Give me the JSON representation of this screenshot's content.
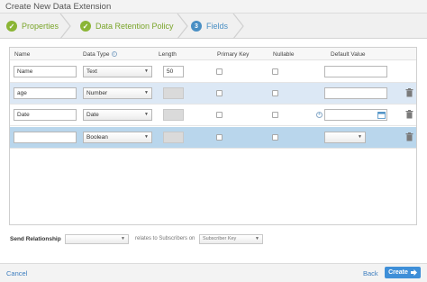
{
  "window": {
    "title": "Create New Data Extension"
  },
  "steps": [
    {
      "label": "Properties",
      "marker": "✓",
      "state": "complete"
    },
    {
      "label": "Data Retention Policy",
      "marker": "✓",
      "state": "complete"
    },
    {
      "label": "Fields",
      "marker": "3",
      "state": "active"
    }
  ],
  "table": {
    "headers": {
      "name": "Name",
      "data_type": "Data Type",
      "length": "Length",
      "primary_key": "Primary Key",
      "nullable": "Nullable",
      "default_value": "Default Value"
    },
    "info_icon": "i",
    "rows": [
      {
        "name": "Name",
        "data_type": "Text",
        "length": "50",
        "length_enabled": true,
        "primary_key": false,
        "nullable": false,
        "default_value": ""
      },
      {
        "name": "age",
        "data_type": "Number",
        "length": "",
        "length_enabled": false,
        "primary_key": false,
        "nullable": false,
        "default_value": ""
      },
      {
        "name": "Date",
        "data_type": "Date",
        "length": "",
        "length_enabled": false,
        "primary_key": false,
        "nullable": false,
        "default_value": ""
      },
      {
        "name": "",
        "data_type": "Boolean",
        "length": "",
        "length_enabled": false,
        "primary_key": false,
        "nullable": false,
        "default_value": ""
      }
    ]
  },
  "relationship": {
    "label": "Send Relationship",
    "field_value": "",
    "connector": "relates to Subscribers on",
    "subscriber_field": "Subscriber Key"
  },
  "footer": {
    "cancel": "Cancel",
    "back": "Back",
    "create": "Create"
  },
  "colors": {
    "complete_step": "#8bb535",
    "active_step": "#4a8fc4",
    "selected_row": "#b9d6ec",
    "alt_row": "#dce8f5",
    "primary_button": "#3f8fd8"
  }
}
